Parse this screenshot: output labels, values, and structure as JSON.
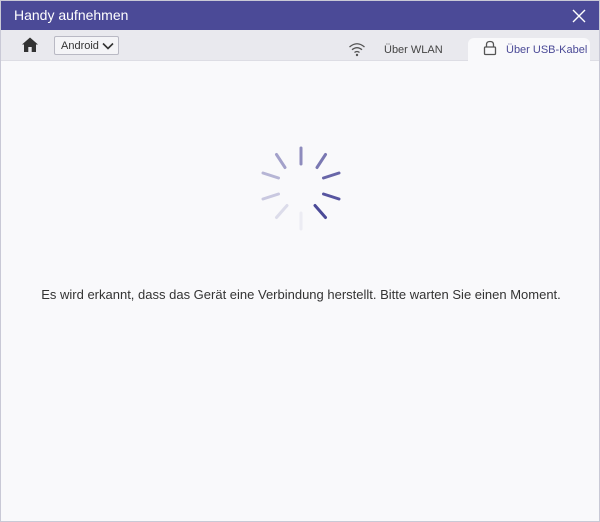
{
  "window": {
    "title": "Handy aufnehmen",
    "close_icon": "close-icon"
  },
  "toolbar": {
    "home_icon": "home-icon",
    "os_select": {
      "selected": "Android",
      "icon": "chevron-down-icon"
    },
    "tabs": [
      {
        "label": "Über WLAN",
        "icon": "wifi-icon",
        "active": false
      },
      {
        "label": "Über USB-Kabel",
        "icon": "lock-icon",
        "active": true
      }
    ]
  },
  "main": {
    "spinner_icon": "loading-spinner-icon",
    "status_message": "Es wird erkannt, dass das Gerät eine Verbindung herstellt. Bitte warten Sie einen Moment."
  },
  "colors": {
    "accent": "#4b4a97",
    "titlebar": "#4b4a97",
    "toolbar_bg": "#e9e9ee",
    "content_bg": "#f9f9fb"
  }
}
